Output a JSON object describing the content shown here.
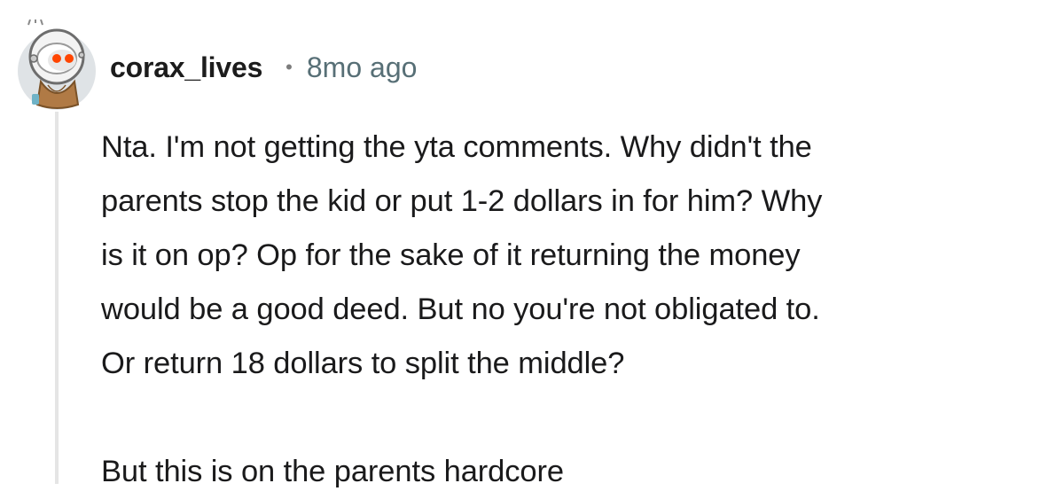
{
  "comment": {
    "author": "corax_lives",
    "separator": "•",
    "timestamp": "8mo ago",
    "avatar_icon": "snoo-astronaut-avatar",
    "lines": [
      "Nta. I'm not getting the yta comments. Why didn't the",
      "parents stop the kid or put 1-2 dollars in for him? Why",
      "is it on op? Op for the sake of it returning the money",
      "would be a good deed. But no you're not obligated to.",
      "Or return 18 dollars to split the middle?"
    ],
    "last_paragraph": "But this is on the parents hardcore"
  },
  "colors": {
    "username": "#1c1c1c",
    "timestamp": "#576f76",
    "body": "#1a1a1b",
    "thread_line": "#e5e5e5"
  }
}
